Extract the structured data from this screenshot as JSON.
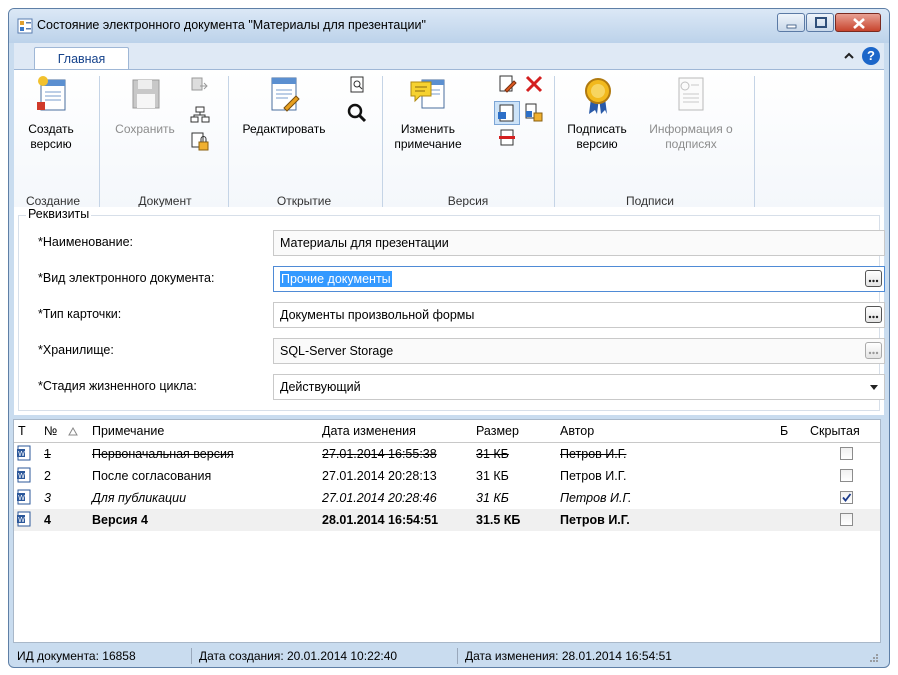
{
  "window": {
    "title": "Состояние электронного документа \"Материалы для презентации\""
  },
  "ribbon": {
    "tab": "Главная",
    "groups": {
      "create": {
        "label": "Создание",
        "create_version": "Создать версию"
      },
      "document": {
        "label": "Документ",
        "save": "Сохранить"
      },
      "open": {
        "label": "Открытие",
        "edit": "Редактировать"
      },
      "version": {
        "label": "Версия",
        "change_note": "Изменить примечание"
      },
      "signatures": {
        "label": "Подписи",
        "sign_version": "Подписать версию",
        "signature_info": "Информация о подписях"
      }
    }
  },
  "props": {
    "legend": "Реквизиты",
    "fields": [
      {
        "label": "*Наименование:",
        "value": "Материалы для презентации"
      },
      {
        "label": "*Вид электронного документа:",
        "value": "Прочие документы"
      },
      {
        "label": "*Тип карточки:",
        "value": "Документы произвольной формы"
      },
      {
        "label": "*Хранилище:",
        "value": "SQL-Server Storage"
      },
      {
        "label": "*Стадия жизненного цикла:",
        "value": "Действующий"
      }
    ]
  },
  "grid": {
    "headers": {
      "type": "Т",
      "num": "№",
      "note": "Примечание",
      "date": "Дата изменения",
      "size": "Размер",
      "author": "Автор",
      "b": "Б",
      "hidden": "Скрытая"
    },
    "rows": [
      {
        "num": "1",
        "note": "Первоначальная версия",
        "date": "27.01.2014 16:55:38",
        "size": "31 КБ",
        "author": "Петров И.Г.",
        "hidden": false
      },
      {
        "num": "2",
        "note": "После согласования",
        "date": "27.01.2014 20:28:13",
        "size": "31 КБ",
        "author": "Петров И.Г.",
        "hidden": false
      },
      {
        "num": "3",
        "note": "Для публикации",
        "date": "27.01.2014 20:28:46",
        "size": "31 КБ",
        "author": "Петров И.Г.",
        "hidden": true
      },
      {
        "num": "4",
        "note": "Версия 4",
        "date": "28.01.2014 16:54:51",
        "size": "31.5 КБ",
        "author": "Петров И.Г.",
        "hidden": false
      }
    ]
  },
  "status": {
    "doc_id": "ИД документа: 16858",
    "created": "Дата создания: 20.01.2014 10:22:40",
    "modified": "Дата изменения: 28.01.2014 16:54:51"
  }
}
